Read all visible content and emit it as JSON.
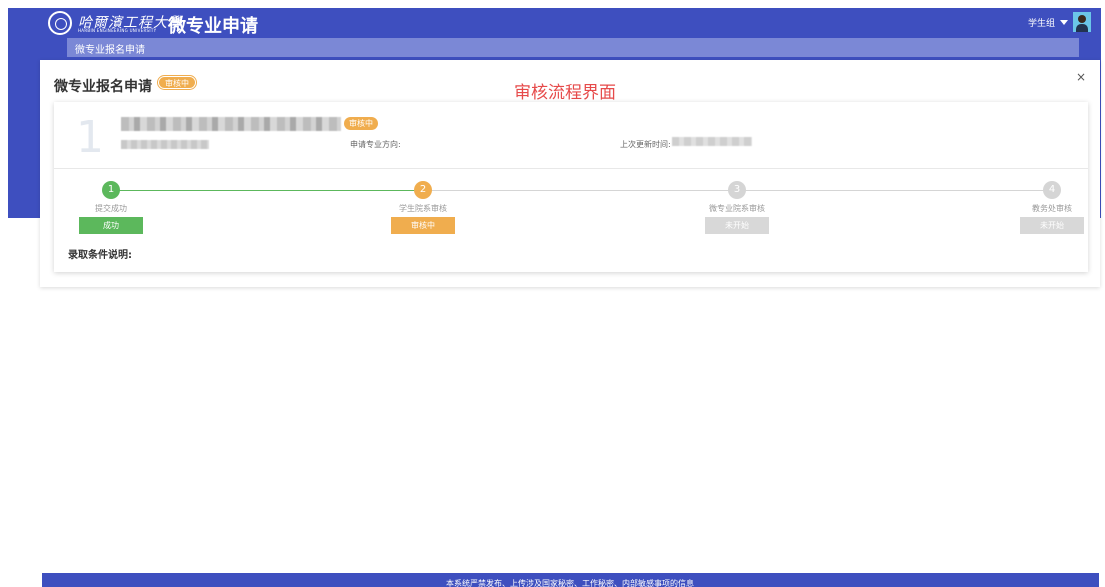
{
  "header": {
    "university_name": "哈爾濱工程大學",
    "university_name_en": "HARBIN ENGINEERING UNIVERSITY",
    "app_title": "微专业申请",
    "user_role": "学生组"
  },
  "breadcrumb": {
    "text": "微专业报名申请"
  },
  "modal": {
    "title": "微专业报名申请",
    "status_badge": "审核中",
    "annotation": "审核流程界面",
    "close_icon": "×"
  },
  "card": {
    "index": "1",
    "status_badge": "审核中",
    "direction_label": "申请专业方向:",
    "updated_label": "上次更新时间:"
  },
  "steps": [
    {
      "number": "1",
      "name": "提交成功",
      "status": "成功",
      "state": "done"
    },
    {
      "number": "2",
      "name": "学生院系审核",
      "status": "审核中",
      "state": "active"
    },
    {
      "number": "3",
      "name": "微专业院系审核",
      "status": "未开始",
      "state": "pending"
    },
    {
      "number": "4",
      "name": "教务处审核",
      "status": "未开始",
      "state": "pending"
    }
  ],
  "admission_label": "录取条件说明:",
  "footer": {
    "text": "本系统严禁发布、上传涉及国家秘密、工作秘密、内部敏感事项的信息"
  },
  "colors": {
    "primary": "#3e4fbf",
    "success": "#5cb85c",
    "warning": "#f0ad4e",
    "pending": "#d8d8d8",
    "annotation": "#e64a4a"
  }
}
